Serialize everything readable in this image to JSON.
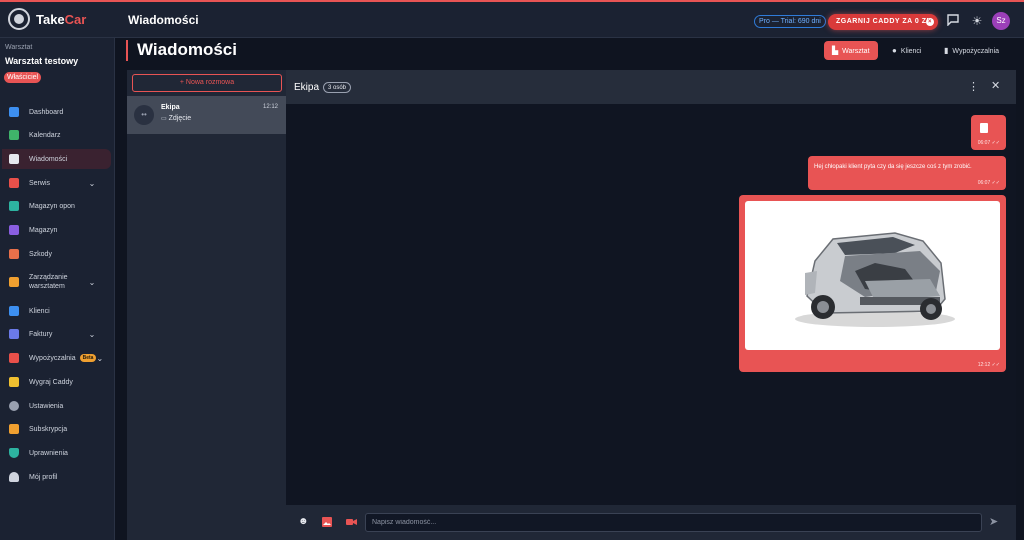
{
  "app": {
    "logo_prefix": "Take",
    "logo_accent": "Car",
    "page_title": "Wiadomości",
    "trial_badge": "Pro — Trial: 690 dni",
    "promo_label": "ZGARNIJ CADDY ZA 0 ZŁ",
    "avatar_initials": "Sz"
  },
  "colors": {
    "accent": "#e85454",
    "background": "#0f1420",
    "panel": "#1b2232"
  },
  "sidebar": {
    "workspace_label": "Warsztat",
    "workspace_name": "Warsztat testowy",
    "role_badge": "Właściciel",
    "items": [
      {
        "label": "Dashboard",
        "icon": "dashboard-icon",
        "color": "#3d8ff0"
      },
      {
        "label": "Kalendarz",
        "icon": "calendar-icon",
        "color": "#3fb36a"
      },
      {
        "label": "Wiadomości",
        "icon": "chat-icon",
        "color": "#e6e8ee",
        "active": true
      },
      {
        "label": "Serwis",
        "icon": "wrench-icon",
        "color": "#e8504a",
        "chevron": true
      },
      {
        "label": "Magazyn opon",
        "icon": "tire-warehouse-icon",
        "color": "#2db3a0"
      },
      {
        "label": "Magazyn",
        "icon": "box-icon",
        "color": "#8a5ee0"
      },
      {
        "label": "Szkody",
        "icon": "hammer-icon",
        "color": "#e8704a"
      },
      {
        "label": "Zarządzanie warsztatem",
        "icon": "tools-icon",
        "color": "#f0a030",
        "chevron": true
      },
      {
        "label": "Klienci",
        "icon": "users-icon",
        "color": "#3d8ff0"
      },
      {
        "label": "Faktury",
        "icon": "invoice-icon",
        "color": "#6b7ae8",
        "chevron": true
      },
      {
        "label": "Wypożyczalnia",
        "icon": "truck-icon",
        "color": "#e8504a",
        "chevron": true,
        "badge": "Beta"
      },
      {
        "label": "Wygraj Caddy",
        "icon": "trophy-icon",
        "color": "#f0c030"
      },
      {
        "label": "Ustawienia",
        "icon": "gear-icon",
        "color": "#9aa1b0"
      },
      {
        "label": "Subskrypcja",
        "icon": "card-icon",
        "color": "#f0a030"
      },
      {
        "label": "Uprawnienia",
        "icon": "shield-icon",
        "color": "#2db3a0"
      },
      {
        "label": "Mój profil",
        "icon": "person-icon",
        "color": "#cfd4de"
      }
    ]
  },
  "header_tabs": [
    {
      "label": "Warsztat",
      "icon": "building-icon",
      "active": true
    },
    {
      "label": "Klienci",
      "icon": "person-icon",
      "active": false
    },
    {
      "label": "Wypożyczalnia",
      "icon": "truck-icon",
      "active": false
    }
  ],
  "conversations": {
    "new_button": "+ Nowa rozmowa",
    "items": [
      {
        "name": "Ekipa",
        "time": "12:12",
        "preview": "Zdjęcie",
        "preview_icon": "photo-icon"
      }
    ]
  },
  "chat": {
    "name": "Ekipa",
    "member_count": "3 osób",
    "messages": [
      {
        "type": "file",
        "time": "06:07 ✓✓"
      },
      {
        "type": "text",
        "text": "Hej chłopaki klient pyta czy da się jeszcze coś z tym zrobić.",
        "time": "06:07 ✓✓"
      },
      {
        "type": "image",
        "subject": "damaged-car-photo",
        "time": "12:12 ✓✓"
      }
    ],
    "input_placeholder": "Napisz wiadomość..."
  }
}
